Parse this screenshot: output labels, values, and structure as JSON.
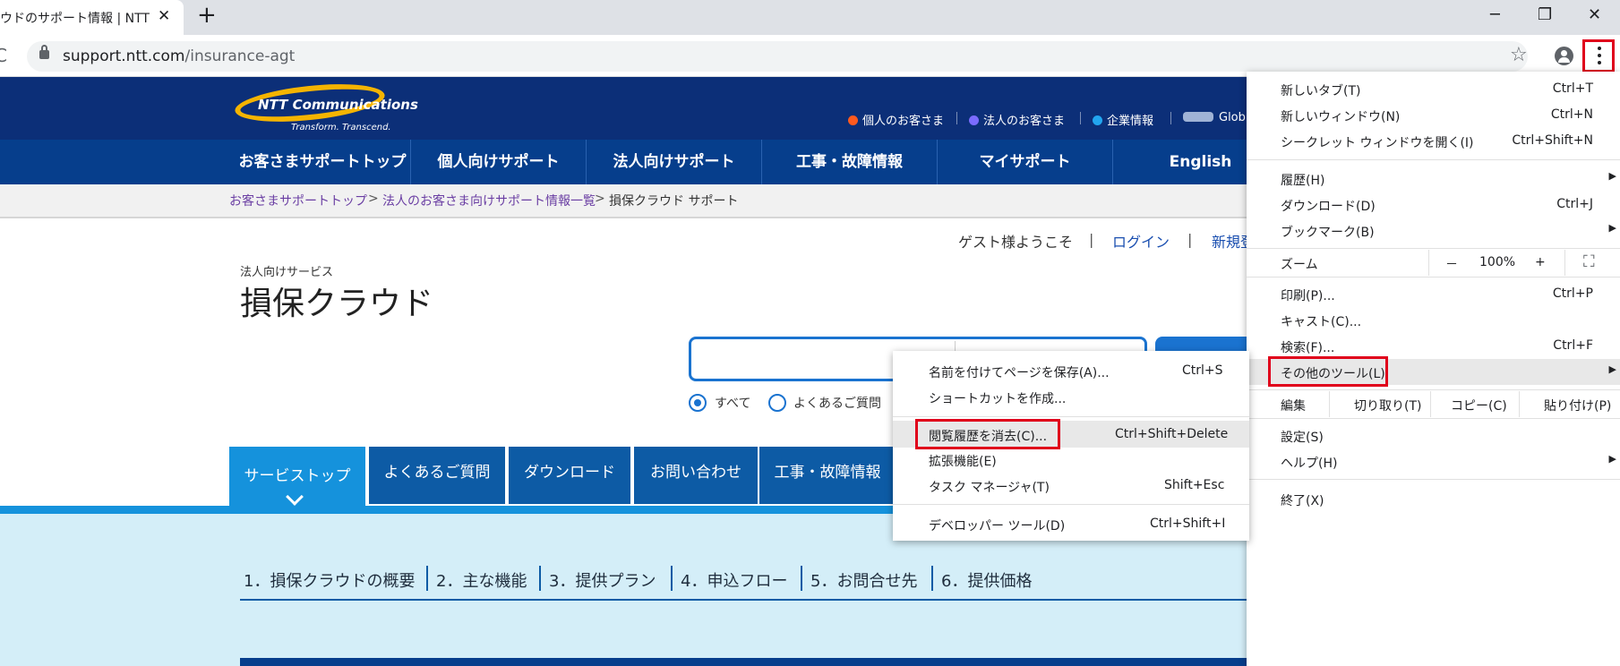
{
  "browser": {
    "tab_title": "ウドのサポート情報 | NTT Co",
    "tab_close": "✕",
    "new_tab": "+",
    "window": {
      "minimize": "─",
      "restore": "❐",
      "close": "✕"
    },
    "reload": "C",
    "url_host": "support.ntt.com",
    "url_path": "/insurance-agt",
    "bookmark_star": "☆"
  },
  "site": {
    "logo_text": "NTT Communications",
    "logo_tagline": "Transform. Transcend.",
    "top_links": [
      "個人のお客さま",
      "法人のお客さま",
      "企業情報",
      "Glob"
    ],
    "nav": [
      "お客さまサポートトップ",
      "個人向けサポート",
      "法人向けサポート",
      "工事・故障情報",
      "マイサポート",
      "English"
    ],
    "breadcrumb": [
      "お客さまサポートトップ",
      "法人のお客さま向けサポート情報一覧",
      "損保クラウド サポート"
    ],
    "breadcrumb_sep": ">",
    "account": {
      "greeting": "ゲスト様ようこそ",
      "login": "ログイン",
      "register": "新規登",
      "divider": "|"
    },
    "page_kicker": "法人向けサービス",
    "page_title": "損保クラウド",
    "search_scope": [
      "すべて",
      "よくあるご質問"
    ],
    "page_tabs": [
      "サービストップ",
      "よくあるご質問",
      "ダウンロード",
      "お問い合わせ",
      "工事・故障情報"
    ],
    "toc": [
      "1．損保クラウドの概要",
      "2．主な機能",
      "3．提供プラン",
      "4．申込フロー",
      "5．お問合せ先",
      "6．提供価格"
    ]
  },
  "chrome_menu": {
    "items1": [
      {
        "label": "新しいタブ(T)",
        "shortcut": "Ctrl+T"
      },
      {
        "label": "新しいウィンドウ(N)",
        "shortcut": "Ctrl+N"
      },
      {
        "label": "シークレット ウィンドウを開く(I)",
        "shortcut": "Ctrl+Shift+N"
      }
    ],
    "items2": [
      {
        "label": "履歴(H)",
        "shortcut": ""
      },
      {
        "label": "ダウンロード(D)",
        "shortcut": "Ctrl+J"
      },
      {
        "label": "ブックマーク(B)",
        "shortcut": ""
      }
    ],
    "zoom": {
      "label": "ズーム",
      "minus": "－",
      "value": "100%",
      "plus": "+",
      "fullscreen": "⛶"
    },
    "items3": [
      {
        "label": "印刷(P)...",
        "shortcut": "Ctrl+P"
      },
      {
        "label": "キャスト(C)...",
        "shortcut": ""
      },
      {
        "label": "検索(F)...",
        "shortcut": "Ctrl+F"
      },
      {
        "label": "その他のツール(L)",
        "shortcut": ""
      }
    ],
    "edit": {
      "label": "編集",
      "cut": "切り取り(T)",
      "copy": "コピー(C)",
      "paste": "貼り付け(P)"
    },
    "items4": [
      {
        "label": "設定(S)",
        "shortcut": ""
      },
      {
        "label": "ヘルプ(H)",
        "shortcut": ""
      }
    ],
    "exit": "終了(X)",
    "submenu_arrow": "▶"
  },
  "more_tools_menu": {
    "items": [
      {
        "label": "名前を付けてページを保存(A)...",
        "shortcut": "Ctrl+S"
      },
      {
        "label": "ショートカットを作成...",
        "shortcut": ""
      },
      {
        "label": "閲覧履歴を消去(C)...",
        "shortcut": "Ctrl+Shift+Delete"
      },
      {
        "label": "拡張機能(E)",
        "shortcut": ""
      },
      {
        "label": "タスク マネージャ(T)",
        "shortcut": "Shift+Esc"
      },
      {
        "label": "デベロッパー ツール(D)",
        "shortcut": "Ctrl+Shift+I"
      }
    ]
  }
}
